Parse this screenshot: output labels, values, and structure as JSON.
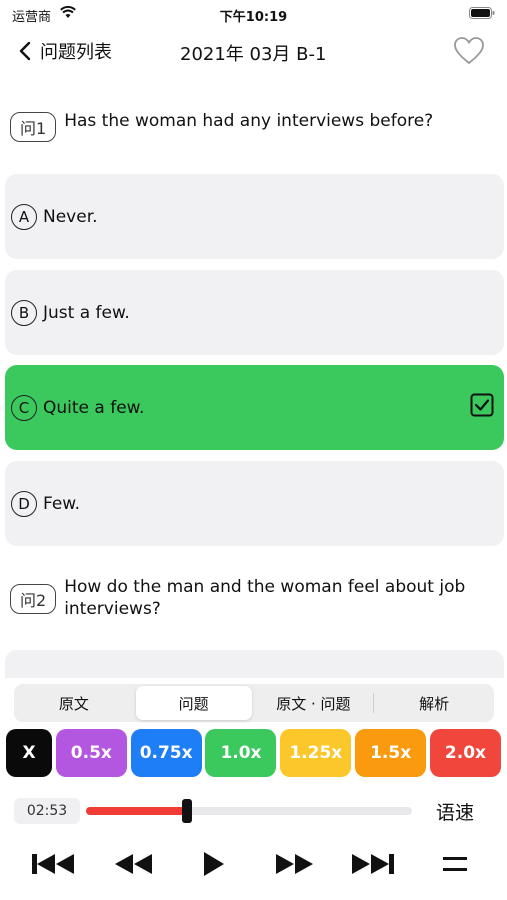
{
  "status": {
    "carrier": "运营商",
    "time": "下午10:19"
  },
  "nav": {
    "back_label": "问题列表",
    "title": "2021年 03月 B-1"
  },
  "question1": {
    "badge": "问1",
    "text": "Has the woman had any interviews before?",
    "options": [
      {
        "letter": "A",
        "text": "Never."
      },
      {
        "letter": "B",
        "text": "Just a few."
      },
      {
        "letter": "C",
        "text": "Quite a few."
      },
      {
        "letter": "D",
        "text": "Few."
      }
    ],
    "selected": "C"
  },
  "question2": {
    "badge": "问2",
    "text": "How do the man and the woman feel about job interviews?"
  },
  "tabs": [
    "原文",
    "问题",
    "原文 · 问题",
    "解析"
  ],
  "active_tab": "问题",
  "speeds": [
    {
      "label": "X",
      "color": "#0a0a0a"
    },
    {
      "label": "0.5x",
      "color": "#b356e0"
    },
    {
      "label": "0.75x",
      "color": "#1e7ef5"
    },
    {
      "label": "1.0x",
      "color": "#3bc85d"
    },
    {
      "label": "1.25x",
      "color": "#fcc72a"
    },
    {
      "label": "1.5x",
      "color": "#fa9a0e"
    },
    {
      "label": "2.0x",
      "color": "#f0463c"
    }
  ],
  "player": {
    "current_time": "02:53",
    "progress": 0.31,
    "speed_label": "语速"
  },
  "colors": {
    "selected_green": "#3bc85d",
    "progress_red": "#f03c35"
  }
}
